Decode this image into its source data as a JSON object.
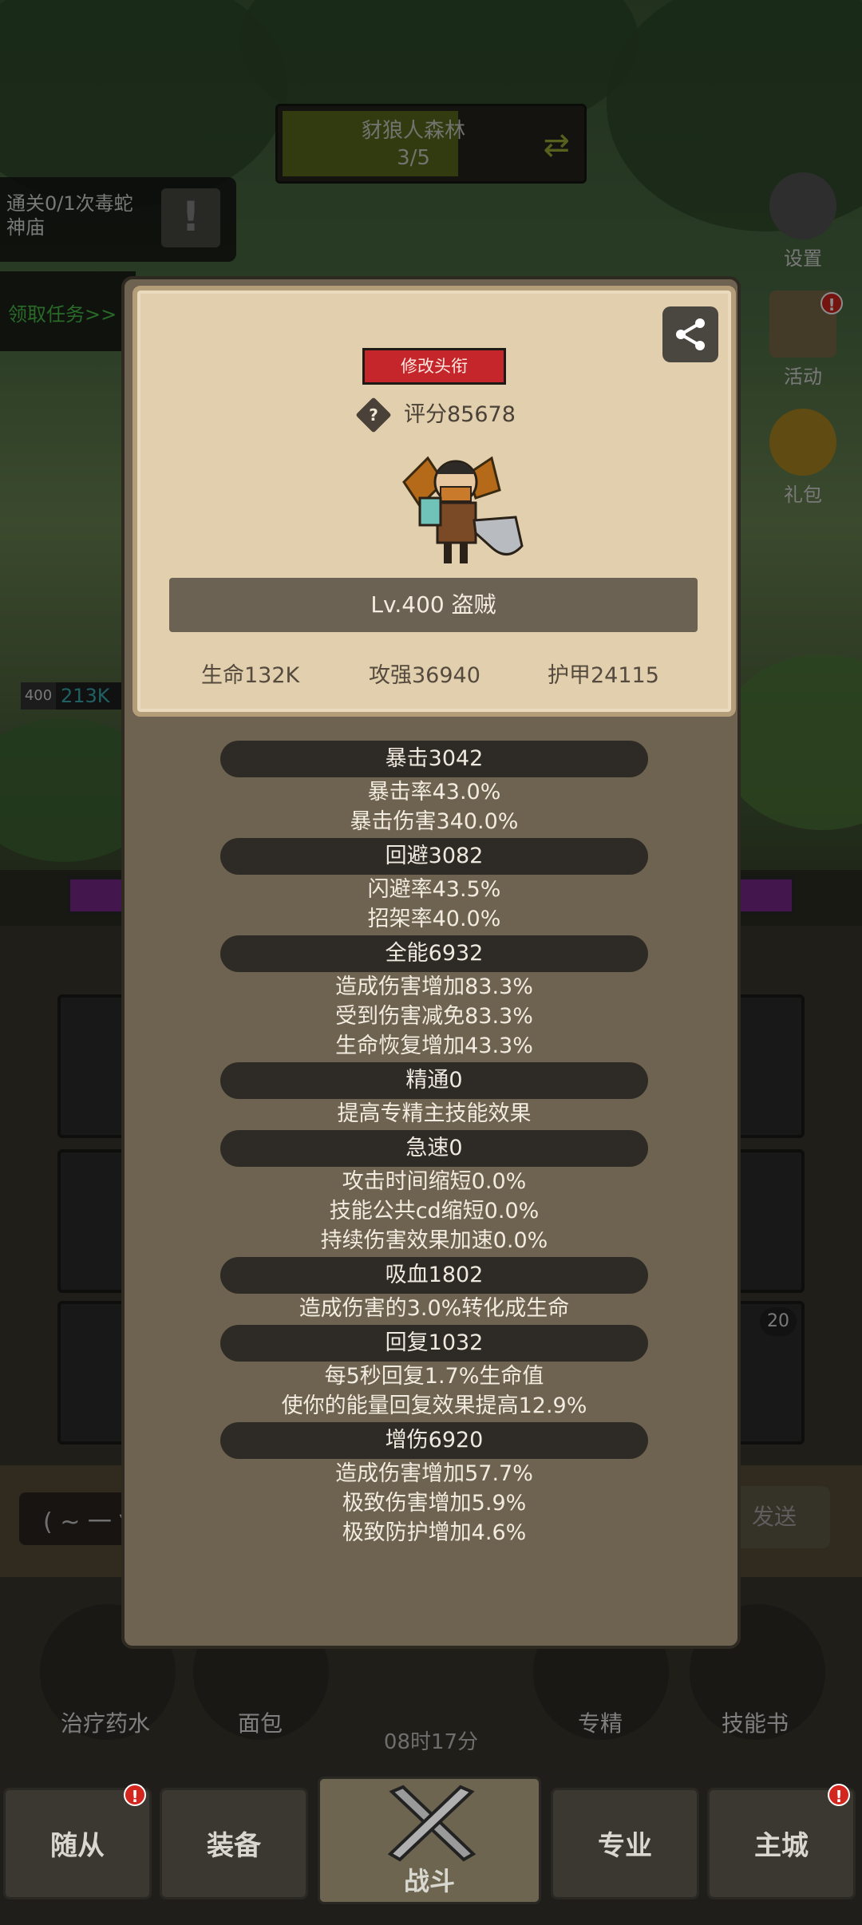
{
  "stage": {
    "name": "豺狼人森林",
    "progress": "3/5"
  },
  "quest": {
    "text": "通关0/1次毒蛇神庙",
    "claim_label": "领取任务>>"
  },
  "side_buttons": [
    {
      "label": "设置",
      "icon": "gear-icon"
    },
    {
      "label": "活动",
      "icon": "scroll-icon",
      "badge": "!"
    },
    {
      "label": "礼包",
      "icon": "gift-coin-icon"
    }
  ],
  "party_hp": {
    "level": "400",
    "value": "213K"
  },
  "chat": {
    "input_value": "( ~ 一 ▽",
    "send_label": "发送"
  },
  "items": [
    {
      "label": "治疗药水",
      "icon": "potion-icon"
    },
    {
      "label": "面包",
      "icon": "bread-icon"
    },
    {
      "label": "专精",
      "icon": "target-icon"
    },
    {
      "label": "技能书",
      "icon": "book-icon"
    }
  ],
  "timer": "08时17分",
  "skill_count": "20",
  "nav": [
    {
      "label": "随从",
      "badge": "!"
    },
    {
      "label": "装备"
    },
    {
      "label": "战斗",
      "active": true
    },
    {
      "label": "专业"
    },
    {
      "label": "主城",
      "badge": "!"
    }
  ],
  "profile": {
    "title_button": "修改头衔",
    "score": "评分85678",
    "level_class": "Lv.400 盗贼",
    "stats": {
      "hp": "生命132K",
      "attack": "攻强36940",
      "armor": "护甲24115"
    }
  },
  "attributes": [
    {
      "header": "暴击3042",
      "lines": [
        "暴击率43.0%",
        "暴击伤害340.0%"
      ]
    },
    {
      "header": "回避3082",
      "lines": [
        "闪避率43.5%",
        "招架率40.0%"
      ]
    },
    {
      "header": "全能6932",
      "lines": [
        "造成伤害增加83.3%",
        "受到伤害减免83.3%",
        "生命恢复增加43.3%"
      ]
    },
    {
      "header": "精通0",
      "lines": [
        "提高专精主技能效果"
      ]
    },
    {
      "header": "急速0",
      "lines": [
        "攻击时间缩短0.0%",
        "技能公共cd缩短0.0%",
        "持续伤害效果加速0.0%"
      ]
    },
    {
      "header": "吸血1802",
      "lines": [
        "造成伤害的3.0%转化成生命"
      ]
    },
    {
      "header": "回复1032",
      "lines": [
        "每5秒回复1.7%生命值",
        "使你的能量回复效果提高12.9%"
      ]
    },
    {
      "header": "增伤6920",
      "lines": [
        "造成伤害增加57.7%",
        "极致伤害增加5.9%",
        "极致防护增加4.6%"
      ]
    }
  ]
}
